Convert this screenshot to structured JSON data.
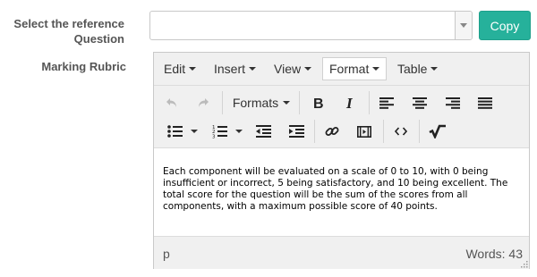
{
  "form": {
    "reference_label": "Select the reference Question",
    "rubric_label": "Marking Rubric",
    "select_value": "",
    "copy_label": "Copy"
  },
  "editor": {
    "menus": [
      "Edit",
      "Insert",
      "View",
      "Format",
      "Table"
    ],
    "active_menu": "Format",
    "formats_label": "Formats",
    "toolbar_icons": [
      "undo-icon",
      "redo-icon",
      "bold-icon",
      "italic-icon",
      "align-left-icon",
      "align-center-icon",
      "align-right-icon",
      "align-justify-icon",
      "bullet-list-icon",
      "numbered-list-icon",
      "outdent-icon",
      "indent-icon",
      "link-icon",
      "media-icon",
      "code-icon",
      "equation-icon"
    ],
    "content": "Each component will be evaluated on a scale of 0 to 10, with 0 being insufficient or incorrect, 5 being satisfactory, and 10 being excellent. The total score for the question will be the sum of the scores from all components, with a maximum possible score of 40 points.",
    "path": "p",
    "word_count": "Words: 43"
  },
  "colors": {
    "accent": "#26b19b",
    "toolbar_bg": "#f0f0f0",
    "border": "#c9c9c9"
  }
}
